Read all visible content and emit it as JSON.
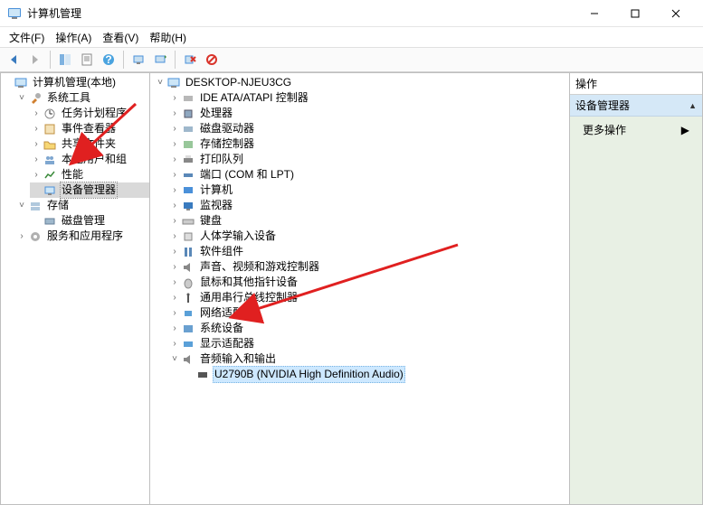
{
  "window": {
    "title": "计算机管理",
    "min_label": "最小化",
    "max_label": "最大化",
    "close_label": "关闭"
  },
  "menu": {
    "file": "文件(F)",
    "action": "操作(A)",
    "view": "查看(V)",
    "help": "帮助(H)"
  },
  "left_tree": {
    "root": "计算机管理(本地)",
    "system_tools": "系统工具",
    "task_scheduler": "任务计划程序",
    "event_viewer": "事件查看器",
    "shared_folders": "共享文件夹",
    "local_users": "本地用户和组",
    "performance": "性能",
    "device_manager": "设备管理器",
    "storage": "存储",
    "disk_mgmt": "磁盘管理",
    "services_apps": "服务和应用程序"
  },
  "device_tree": {
    "root": "DESKTOP-NJEU3CG",
    "ide": "IDE ATA/ATAPI 控制器",
    "cpu": "处理器",
    "disk_drives": "磁盘驱动器",
    "storage_ctrl": "存储控制器",
    "print_queues": "打印队列",
    "ports": "端口 (COM 和 LPT)",
    "computer": "计算机",
    "monitors": "监视器",
    "keyboards": "键盘",
    "hid": "人体学输入设备",
    "software_comp": "软件组件",
    "sound_video_game": "声音、视频和游戏控制器",
    "mice": "鼠标和其他指针设备",
    "usb_ctrl": "通用串行总线控制器",
    "network": "网络适配器",
    "system_devices": "系统设备",
    "display": "显示适配器",
    "audio_io": "音频输入和输出",
    "audio_device": "U2790B (NVIDIA High Definition Audio)"
  },
  "actions": {
    "header": "操作",
    "subheader": "设备管理器",
    "more": "更多操作"
  }
}
